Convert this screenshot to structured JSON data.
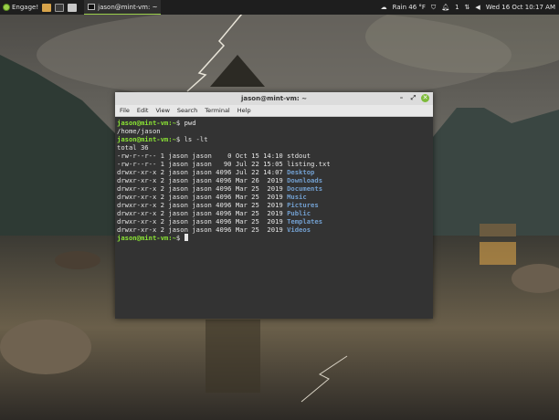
{
  "panel": {
    "menu_label": "Engage!",
    "task_title": "jason@mint-vm: ~",
    "weather": "Rain 46 °F",
    "notifications": "1",
    "datetime": "Wed 16 Oct 10:17 AM",
    "accent": "#9bd04a"
  },
  "window": {
    "title": "jason@mint-vm: ~",
    "menu": [
      "File",
      "Edit",
      "View",
      "Search",
      "Terminal",
      "Help"
    ],
    "controls": [
      "minimize",
      "maximize",
      "close"
    ]
  },
  "terminal": {
    "lines": [
      {
        "prompt": "jason@mint-vm:",
        "cwd": "~",
        "cmd": "$ pwd"
      },
      {
        "text": "/home/jason"
      },
      {
        "prompt": "jason@mint-vm:",
        "cwd": "~",
        "cmd": "$ ls -lt"
      },
      {
        "text": "total 36"
      },
      {
        "text": "-rw-r--r-- 1 jason jason    0 Oct 15 14:10 ",
        "name": "stdout",
        "dir": false
      },
      {
        "text": "-rw-r--r-- 1 jason jason   90 Jul 22 15:05 ",
        "name": "listing.txt",
        "dir": false
      },
      {
        "text": "drwxr-xr-x 2 jason jason 4096 Jul 22 14:07 ",
        "name": "Desktop",
        "dir": true
      },
      {
        "text": "drwxr-xr-x 2 jason jason 4096 Mar 26  2019 ",
        "name": "Downloads",
        "dir": true
      },
      {
        "text": "drwxr-xr-x 2 jason jason 4096 Mar 25  2019 ",
        "name": "Documents",
        "dir": true
      },
      {
        "text": "drwxr-xr-x 2 jason jason 4096 Mar 25  2019 ",
        "name": "Music",
        "dir": true
      },
      {
        "text": "drwxr-xr-x 2 jason jason 4096 Mar 25  2019 ",
        "name": "Pictures",
        "dir": true
      },
      {
        "text": "drwxr-xr-x 2 jason jason 4096 Mar 25  2019 ",
        "name": "Public",
        "dir": true
      },
      {
        "text": "drwxr-xr-x 2 jason jason 4096 Mar 25  2019 ",
        "name": "Templates",
        "dir": true
      },
      {
        "text": "drwxr-xr-x 2 jason jason 4096 Mar 25  2019 ",
        "name": "Videos",
        "dir": true
      },
      {
        "prompt": "jason@mint-vm:",
        "cwd": "~",
        "cmd": "$ ",
        "cursor": true
      }
    ],
    "colors": {
      "prompt": "#8ae234",
      "directory": "#729fcf",
      "background": "#333333"
    }
  }
}
